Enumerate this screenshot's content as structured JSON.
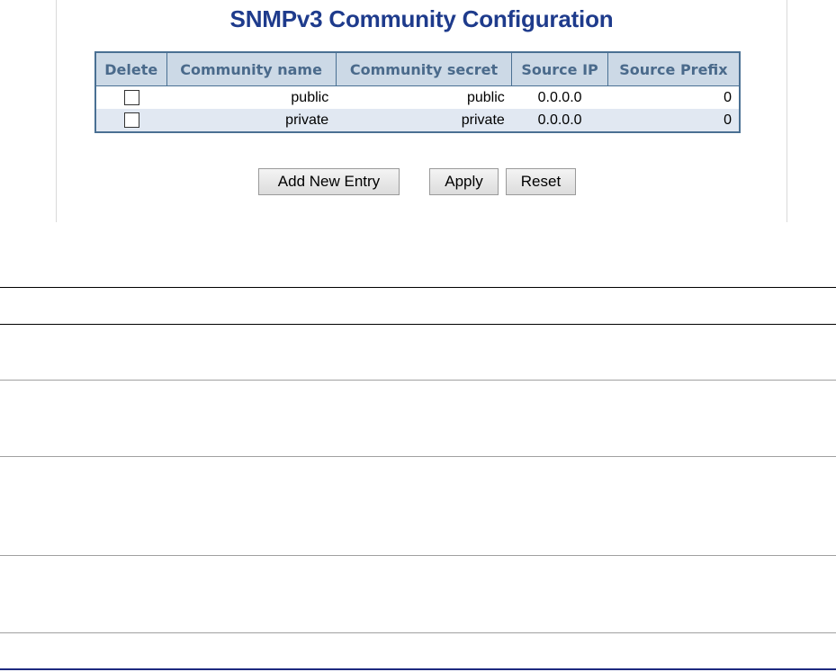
{
  "page": {
    "title": "SNMPv3 Community Configuration"
  },
  "table": {
    "headers": [
      "Delete",
      "Community name",
      "Community secret",
      "Source IP",
      "Source Prefix"
    ],
    "rows": [
      {
        "name": "public",
        "secret": "public",
        "source_ip": "0.0.0.0",
        "source_prefix": "0",
        "delete_checked": false
      },
      {
        "name": "private",
        "secret": "private",
        "source_ip": "0.0.0.0",
        "source_prefix": "0",
        "delete_checked": false
      }
    ]
  },
  "buttons": {
    "add_new_entry": "Add New Entry",
    "apply": "Apply",
    "reset": "Reset"
  },
  "colors": {
    "title": "#1e3b8c",
    "header_bg": "#ccd9e6",
    "header_text": "#4a6a8b",
    "table_border": "#4a7093",
    "row_alt_bg": "#e1e8f2"
  }
}
